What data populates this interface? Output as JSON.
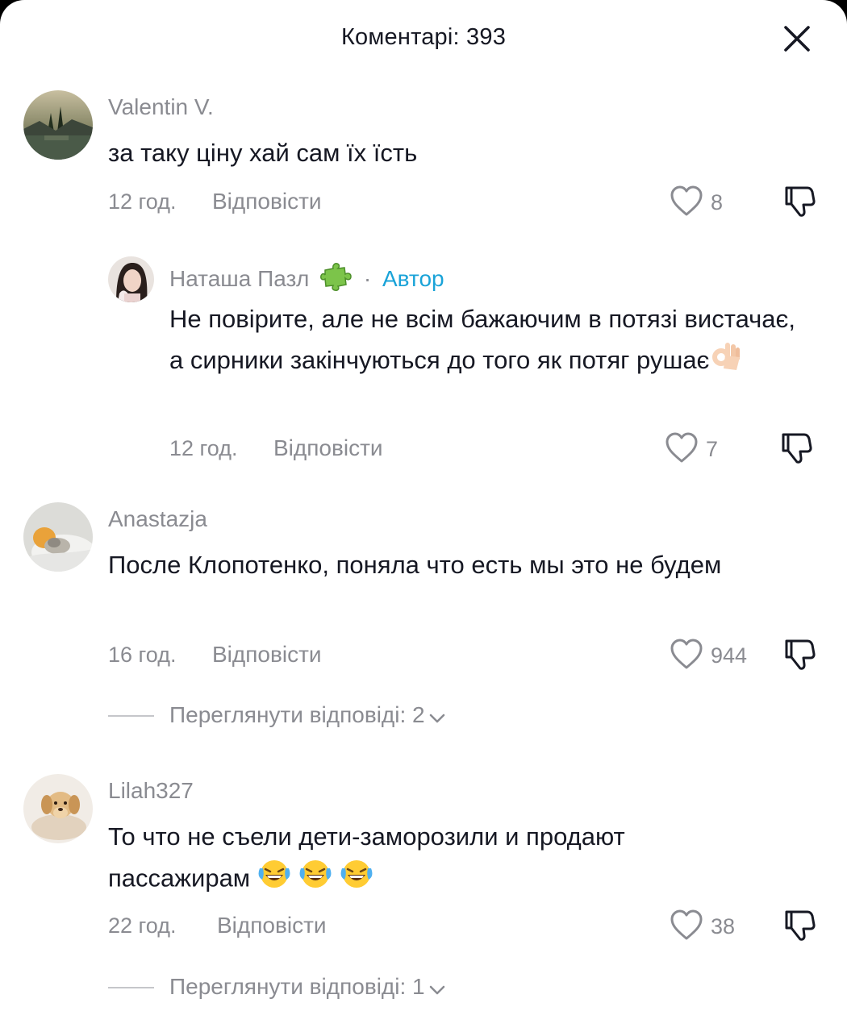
{
  "header": {
    "title": "Коментарі: 393"
  },
  "comments": [
    {
      "username": "Valentin V.",
      "text": "за таку ціну хай сам їх їсть",
      "time": "12 год.",
      "reply_label": "Відповісти",
      "likes": "8"
    },
    {
      "username": "Наташа Пазл",
      "author_badge": "Автор",
      "separator": "·",
      "text": "Не повірите, але не всім бажаючим в потязі вистачає, а сирники закінчуються до того як потяг рушає",
      "emoji": "ok-hand",
      "time": "12 год.",
      "reply_label": "Відповісти",
      "likes": "7"
    },
    {
      "username": "Anastazja",
      "text": "После Клопотенко, поняла что есть мы это не будем",
      "time": "16 год.",
      "reply_label": "Відповісти",
      "likes": "944",
      "view_replies": "Переглянути відповіді: 2"
    },
    {
      "username": "Lilah327",
      "text": "То что не съели дети-заморозили и продают пассажирам",
      "emoji": "laughing-tears x3",
      "time": "22 год.",
      "reply_label": "Відповісти",
      "likes": "38",
      "view_replies": "Переглянути відповіді: 1"
    }
  ],
  "colors": {
    "text": "#161823",
    "muted": "#8a8b91",
    "author": "#1aa3d8"
  }
}
